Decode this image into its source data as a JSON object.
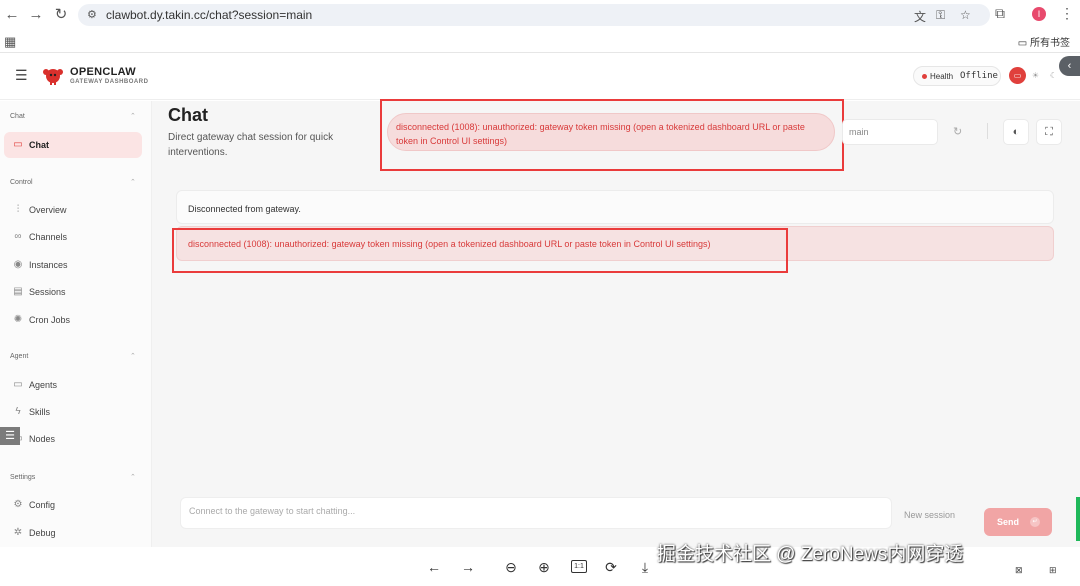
{
  "browser": {
    "back_glyph": "←",
    "forward_glyph": "→",
    "reload_glyph": "↻",
    "site_glyph": "⚙",
    "url": "clawbot.dy.takin.cc/chat?session=main",
    "translate_glyph": "文",
    "key_glyph": "⚿",
    "star_glyph": "☆",
    "extensions_glyph": "⧉",
    "profile_initial": "I",
    "menu_glyph": "⋮",
    "apps_glyph": "▦",
    "bookmarks_folder": "所有书签",
    "folder_glyph": "▭"
  },
  "app": {
    "menu_glyph": "☰",
    "brand_name": "OPENCLAW",
    "brand_subtitle": "GATEWAY DASHBOARD",
    "health_label": "Health",
    "health_value": "Offline",
    "theme_system_glyph": "▭",
    "theme_light_glyph": "☀",
    "theme_dark_glyph": "☾",
    "collapse_glyph": "‹",
    "accent_color": "#e0403c"
  },
  "sidebar": {
    "groups": [
      {
        "label": "Chat",
        "chevron": "⌃",
        "items": [
          {
            "label": "Chat",
            "icon": "chat-icon",
            "glyph": "▭",
            "active": true
          }
        ]
      },
      {
        "label": "Control",
        "chevron": "⌃",
        "items": [
          {
            "label": "Overview",
            "icon": "bar-chart-icon",
            "glyph": "⫶"
          },
          {
            "label": "Channels",
            "icon": "link-icon",
            "glyph": "∞"
          },
          {
            "label": "Instances",
            "icon": "radio-icon",
            "glyph": "◉"
          },
          {
            "label": "Sessions",
            "icon": "document-icon",
            "glyph": "▤"
          },
          {
            "label": "Cron Jobs",
            "icon": "loader-icon",
            "glyph": "✺"
          }
        ]
      },
      {
        "label": "Agent",
        "chevron": "⌃",
        "items": [
          {
            "label": "Agents",
            "icon": "folder-icon",
            "glyph": "▭"
          },
          {
            "label": "Skills",
            "icon": "zap-icon",
            "glyph": "ϟ"
          },
          {
            "label": "Nodes",
            "icon": "monitor-icon",
            "glyph": "▭"
          }
        ]
      },
      {
        "label": "Settings",
        "chevron": "⌃",
        "items": [
          {
            "label": "Config",
            "icon": "gear-icon",
            "glyph": "⚙"
          },
          {
            "label": "Debug",
            "icon": "bug-icon",
            "glyph": "✲"
          }
        ]
      }
    ],
    "float_tool_glyph": "☰"
  },
  "main": {
    "title": "Chat",
    "subtitle": "Direct gateway chat session for quick interventions.",
    "error_banner": "disconnected (1008): unauthorized: gateway token missing (open a tokenized dashboard URL or paste token in Control UI settings)",
    "session_value": "main",
    "refresh_glyph": "↻",
    "thinking_glyph": "◐",
    "focus_glyph": "⛶",
    "status_message": "Disconnected from gateway.",
    "error_message": "disconnected (1008): unauthorized: gateway token missing (open a tokenized dashboard URL or paste token in Control UI settings)",
    "composer_placeholder": "Connect to the gateway to start chatting...",
    "new_session_label": "New session",
    "send_label": "Send",
    "send_glyph": "↵"
  },
  "viewer": {
    "prev_glyph": "←",
    "next_glyph": "→",
    "zoom_out_glyph": "⊖",
    "zoom_in_glyph": "⊕",
    "actual_size_label": "1:1",
    "rotate_glyph": "⟳",
    "download_glyph": "⤓",
    "watermark": "掘金技术社区 @ ZeroNews内网穿透",
    "corner_left_glyph": "⊠",
    "corner_right_glyph": "⊞"
  }
}
